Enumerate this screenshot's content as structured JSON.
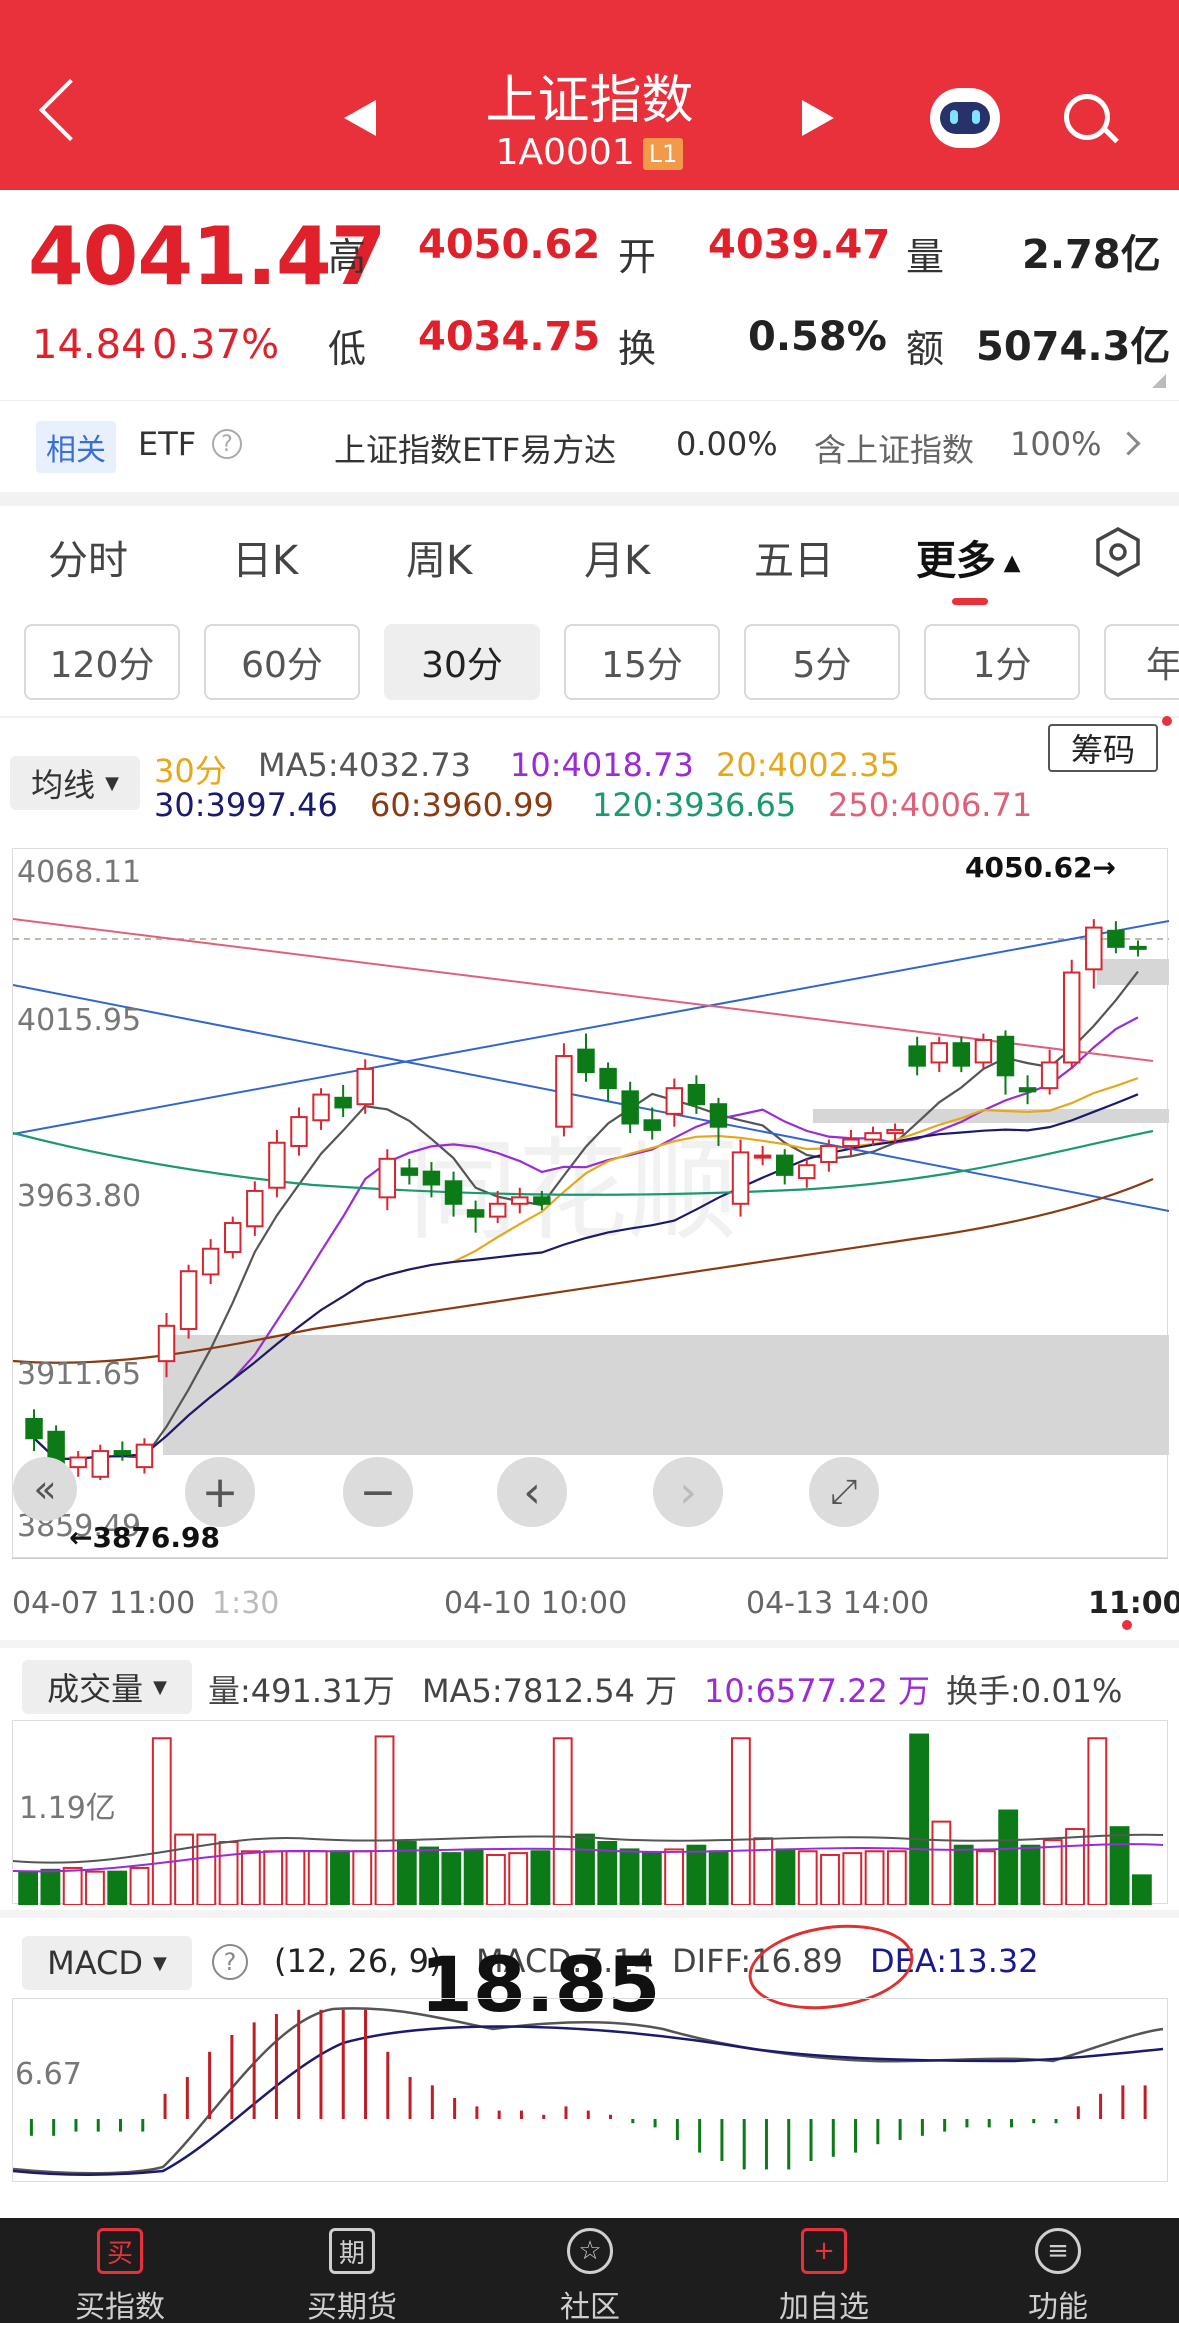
{
  "header": {
    "title": "上证指数",
    "code": "1A0001",
    "badge": "L1"
  },
  "quote": {
    "price": "4041.47",
    "change": "14.84",
    "change_pct": "0.37%",
    "high_label": "高",
    "high": "4050.62",
    "open_label": "开",
    "open": "4039.47",
    "volume_label": "量",
    "volume": "2.78亿",
    "low_label": "低",
    "low": "4034.75",
    "turnover_label": "换",
    "turnover": "0.58%",
    "amount_label": "额",
    "amount": "5074.3亿"
  },
  "etf": {
    "tag": "相关",
    "label": "ETF",
    "name": "上证指数ETF易方达",
    "change": "0.00%",
    "contains": "含上证指数",
    "weight": "100%"
  },
  "period_tabs": [
    "分时",
    "日K",
    "周K",
    "月K",
    "五日",
    "更多"
  ],
  "minute_pills": [
    "120分",
    "60分",
    "30分",
    "15分",
    "5分",
    "1分",
    "年"
  ],
  "active_pill": "30分",
  "chips_button": "筹码",
  "ma": {
    "selector": "均线",
    "period": "30分",
    "ma5": "MA5:4032.73",
    "ma10": "10:4018.73",
    "ma20": "20:4002.35",
    "ma30": "30:3997.46",
    "ma60": "60:3960.99",
    "ma120": "120:3936.65",
    "ma250": "250:4006.71",
    "colors": {
      "ma5": "#555555",
      "ma10": "#9a2bd6",
      "ma20": "#e6a81a",
      "ma30": "#1a1a6e",
      "ma60": "#8a3b12",
      "ma120": "#1a9a6e",
      "ma250": "#e0607a",
      "trend": "#3366cc"
    }
  },
  "kline": {
    "y_labels": [
      "4068.11",
      "4015.95",
      "3963.80",
      "3911.65",
      "3859.49"
    ],
    "high_marker": "4050.62→",
    "low_marker": "←3876.98",
    "x_labels": [
      "04-07 11:00",
      "1:30",
      "04-10 10:00",
      "04-13 14:00",
      "11:00"
    ],
    "watermark": "同花顺"
  },
  "chart_controls": [
    "«",
    "+",
    "−",
    "‹",
    "›",
    "⤢"
  ],
  "volume": {
    "selector": "成交量",
    "vol": "量:491.31万",
    "ma5": "MA5:7812.54 万",
    "ma10": "10:6577.22 万",
    "turnover": "换手:0.01%",
    "y_label": "1.19亿"
  },
  "macd": {
    "selector": "MACD",
    "params": "(12, 26, 9)",
    "macd": "MACD:7.14",
    "diff": "DIFF:16.89",
    "dea": "DEA:13.32",
    "y_label": "6.67",
    "annotation": "18.85"
  },
  "bottom_nav": [
    {
      "label": "买指数",
      "icon": "买"
    },
    {
      "label": "买期货",
      "icon": "期"
    },
    {
      "label": "社区",
      "icon": "☆"
    },
    {
      "label": "加自选",
      "icon": "+"
    },
    {
      "label": "功能",
      "icon": "≡"
    }
  ],
  "chart_data": {
    "type": "candlestick",
    "candles": [
      {
        "o": 3895,
        "c": 3889,
        "h": 3898,
        "l": 3885
      },
      {
        "o": 3891,
        "c": 3876,
        "h": 3893,
        "l": 3875
      },
      {
        "o": 3880,
        "c": 3883,
        "h": 3885,
        "l": 3877
      },
      {
        "o": 3877,
        "c": 3885,
        "h": 3887,
        "l": 3876
      },
      {
        "o": 3885,
        "c": 3884,
        "h": 3888,
        "l": 3882
      },
      {
        "o": 3880,
        "c": 3887,
        "h": 3889,
        "l": 3878
      },
      {
        "o": 3913,
        "c": 3924,
        "h": 3928,
        "l": 3908
      },
      {
        "o": 3923,
        "c": 3941,
        "h": 3943,
        "l": 3920
      },
      {
        "o": 3940,
        "c": 3948,
        "h": 3951,
        "l": 3937
      },
      {
        "o": 3947,
        "c": 3956,
        "h": 3958,
        "l": 3945
      },
      {
        "o": 3955,
        "c": 3966,
        "h": 3969,
        "l": 3952
      },
      {
        "o": 3967,
        "c": 3981,
        "h": 3985,
        "l": 3964
      },
      {
        "o": 3980,
        "c": 3989,
        "h": 3992,
        "l": 3977
      },
      {
        "o": 3988,
        "c": 3996,
        "h": 3998,
        "l": 3985
      },
      {
        "o": 3995,
        "c": 3992,
        "h": 3999,
        "l": 3989
      },
      {
        "o": 3993,
        "c": 4004,
        "h": 4007,
        "l": 3990
      },
      {
        "o": 3964,
        "c": 3976,
        "h": 3979,
        "l": 3960
      },
      {
        "o": 3973,
        "c": 3971,
        "h": 3976,
        "l": 3968
      },
      {
        "o": 3972,
        "c": 3968,
        "h": 3975,
        "l": 3964
      },
      {
        "o": 3969,
        "c": 3962,
        "h": 3972,
        "l": 3958
      },
      {
        "o": 3960,
        "c": 3958,
        "h": 3963,
        "l": 3953
      },
      {
        "o": 3958,
        "c": 3962,
        "h": 3966,
        "l": 3956
      },
      {
        "o": 3962,
        "c": 3964,
        "h": 3967,
        "l": 3959
      },
      {
        "o": 3964,
        "c": 3962,
        "h": 3966,
        "l": 3960
      },
      {
        "o": 3986,
        "c": 4008,
        "h": 4012,
        "l": 3983
      },
      {
        "o": 4010,
        "c": 4003,
        "h": 4015,
        "l": 4000
      },
      {
        "o": 4004,
        "c": 3998,
        "h": 4006,
        "l": 3994
      },
      {
        "o": 3997,
        "c": 3987,
        "h": 4000,
        "l": 3984
      },
      {
        "o": 3988,
        "c": 3985,
        "h": 3992,
        "l": 3982
      },
      {
        "o": 3990,
        "c": 3998,
        "h": 4001,
        "l": 3986
      },
      {
        "o": 3999,
        "c": 3993,
        "h": 4002,
        "l": 3990
      },
      {
        "o": 3993,
        "c": 3986,
        "h": 3995,
        "l": 3980
      },
      {
        "o": 3962,
        "c": 3978,
        "h": 3982,
        "l": 3958
      },
      {
        "o": 3977,
        "c": 3977,
        "h": 3980,
        "l": 3974
      },
      {
        "o": 3977,
        "c": 3971,
        "h": 3979,
        "l": 3968
      },
      {
        "o": 3970,
        "c": 3974,
        "h": 3976,
        "l": 3967
      },
      {
        "o": 3975,
        "c": 3980,
        "h": 3982,
        "l": 3972
      },
      {
        "o": 3980,
        "c": 3982,
        "h": 3985,
        "l": 3977
      },
      {
        "o": 3982,
        "c": 3984,
        "h": 3986,
        "l": 3980
      },
      {
        "o": 3984,
        "c": 3985,
        "h": 3987,
        "l": 3981
      },
      {
        "o": 4011,
        "c": 4005,
        "h": 4014,
        "l": 4002
      },
      {
        "o": 4006,
        "c": 4012,
        "h": 4014,
        "l": 4003
      },
      {
        "o": 4012,
        "c": 4005,
        "h": 4014,
        "l": 4003
      },
      {
        "o": 4006,
        "c": 4013,
        "h": 4015,
        "l": 4004
      },
      {
        "o": 4014,
        "c": 4002,
        "h": 4016,
        "l": 3996
      },
      {
        "o": 3998,
        "c": 3997,
        "h": 4002,
        "l": 3993
      },
      {
        "o": 3998,
        "c": 4006,
        "h": 4010,
        "l": 3996
      },
      {
        "o": 4006,
        "c": 4034,
        "h": 4038,
        "l": 4004
      },
      {
        "o": 4035,
        "c": 4048,
        "h": 4050.62,
        "l": 4029
      },
      {
        "o": 4047,
        "c": 4042,
        "h": 4050,
        "l": 4040
      },
      {
        "o": 4042,
        "c": 4041.47,
        "h": 4044,
        "l": 4039
      }
    ],
    "volume": [
      36,
      38,
      40,
      36,
      36,
      40,
      180,
      76,
      76,
      68,
      58,
      58,
      58,
      58,
      58,
      58,
      182,
      68,
      62,
      56,
      60,
      54,
      56,
      58,
      180,
      76,
      68,
      60,
      56,
      60,
      64,
      58,
      180,
      72,
      60,
      58,
      54,
      56,
      58,
      58,
      184,
      90,
      64,
      58,
      102,
      64,
      70,
      82,
      180,
      84,
      32
    ],
    "macd_hist": [
      -4,
      -4,
      -3,
      -3,
      -3,
      -3,
      6,
      10,
      16,
      20,
      23,
      25,
      26,
      26,
      26,
      26,
      16,
      10,
      8,
      5,
      3,
      2,
      2,
      1,
      3,
      2,
      1,
      -1,
      -2,
      -5,
      -8,
      -10,
      -12,
      -12,
      -12,
      -10,
      -9,
      -8,
      -6,
      -5,
      -4,
      -3,
      -2,
      -2,
      -2,
      -1,
      -1,
      3,
      6,
      8,
      8
    ],
    "ylim": [
      3859.49,
      4068.11
    ]
  }
}
